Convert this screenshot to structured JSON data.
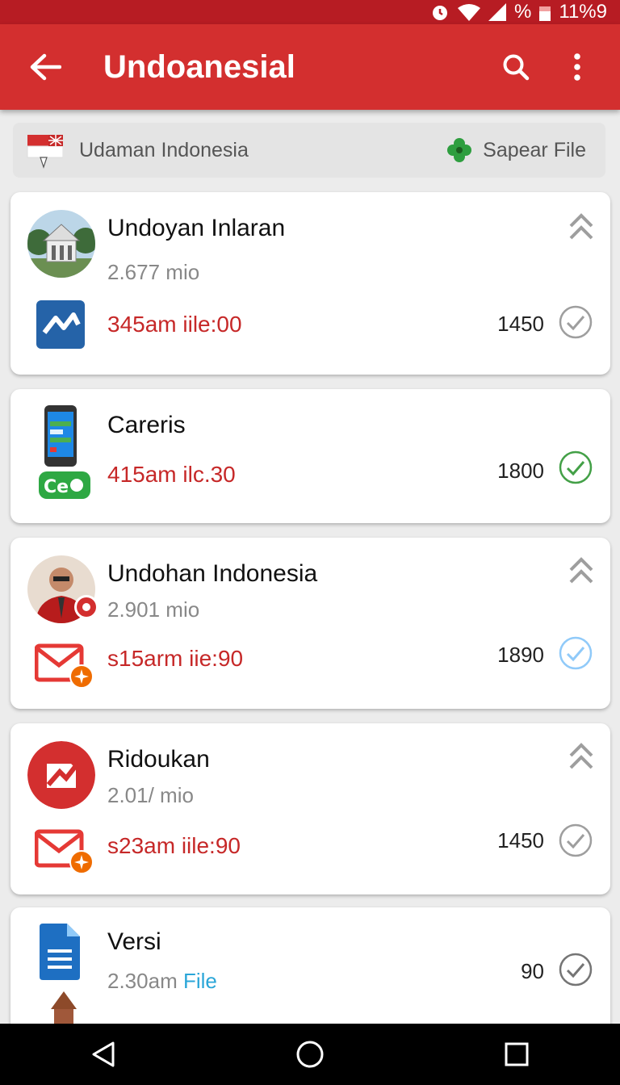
{
  "status": {
    "battery_text": "11%9",
    "percent_glyph": "%"
  },
  "appbar": {
    "title": "Undoanesial",
    "back_icon": "arrow-left-icon",
    "search_icon": "search-icon",
    "menu_icon": "more-vert-icon"
  },
  "filter": {
    "region_label": "Udaman Indonesia",
    "file_label": "Sapear File"
  },
  "cards": [
    {
      "name": "Undoyan Inlaran",
      "subtitle": "2.677 mio",
      "time": "345am iile:00",
      "count": "1450",
      "check_state": "grey"
    },
    {
      "name": "Careris",
      "time": "415am ilc.30",
      "count": "1800",
      "check_state": "green",
      "app_badge": "Ce"
    },
    {
      "name": "Undohan Indonesia",
      "subtitle": "2.901 mio",
      "time": "s15arm iie:90",
      "count": "1890",
      "check_state": "blue"
    },
    {
      "name": "Ridoukan",
      "subtitle": "2.01/ mio",
      "time": "s23am iile:90",
      "count": "1450",
      "check_state": "grey"
    },
    {
      "name": "Versi",
      "subtitle_prefix": "2.30am",
      "subtitle_file": "File",
      "count": "90",
      "check_state": "dark"
    }
  ],
  "colors": {
    "primary": "#d32f2f",
    "statusbar": "#b71c23",
    "time_text": "#c62828",
    "check_green": "#43a047",
    "check_blue": "#90caf9",
    "check_grey": "#9e9e9e"
  }
}
